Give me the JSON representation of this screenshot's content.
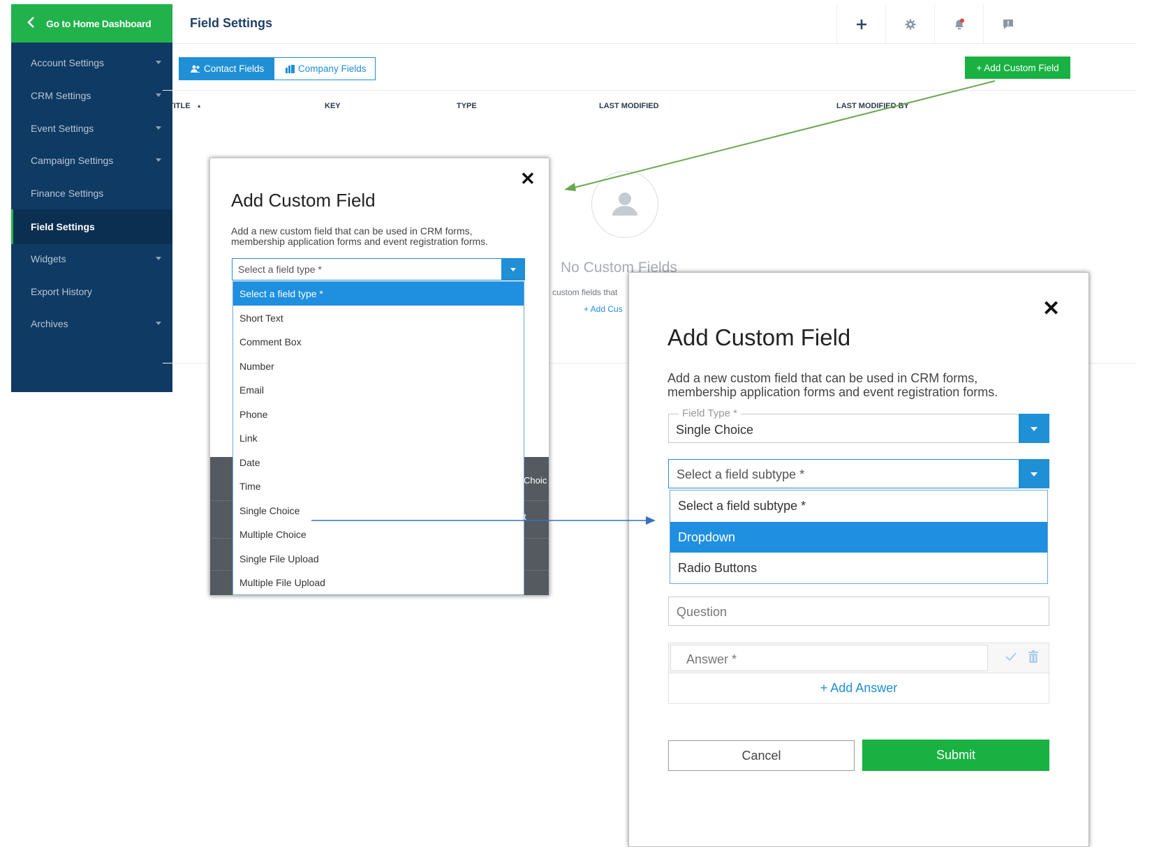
{
  "sidebar": {
    "home_label": "Go to Home Dashboard",
    "items": [
      {
        "label": "Account Settings",
        "caret": true
      },
      {
        "label": "CRM Settings",
        "caret": true
      },
      {
        "label": "Event Settings",
        "caret": true
      },
      {
        "label": "Campaign Settings",
        "caret": true
      },
      {
        "label": "Finance Settings",
        "caret": false
      },
      {
        "label": "Field Settings",
        "caret": false,
        "active": true
      },
      {
        "label": "Widgets",
        "caret": true
      },
      {
        "label": "Export History",
        "caret": false
      },
      {
        "label": "Archives",
        "caret": true
      }
    ]
  },
  "header": {
    "title": "Field Settings",
    "icons": [
      "plus-icon",
      "gear-icon",
      "bell-icon",
      "chat-icon"
    ]
  },
  "tabs": {
    "contact": "Contact Fields",
    "company": "Company Fields"
  },
  "toolbar": {
    "add_custom_field": "+ Add Custom Field"
  },
  "table": {
    "columns": [
      "TITLE",
      "KEY",
      "TYPE",
      "LAST MODIFIED",
      "LAST MODIFIED BY"
    ],
    "sort_indicator": "▲"
  },
  "empty_state": {
    "title": "No Custom Fields",
    "description": "custom fields that",
    "add_link": "+ Add Cus"
  },
  "modal_type_select": {
    "title": "Add Custom Field",
    "description": "Add a new custom field that can be used in CRM forms, membership application forms and event registration forms.",
    "select_placeholder": "Select a field type *",
    "options": [
      "Select a field type *",
      "Short Text",
      "Comment Box",
      "Number",
      "Email",
      "Phone",
      "Link",
      "Date",
      "Time",
      "Single Choice",
      "Multiple Choice",
      "Single File Upload",
      "Multiple File Upload"
    ],
    "selected_index": 0,
    "peek_text_1": "Choic",
    "peek_text_2": "t"
  },
  "modal_subtype_select": {
    "title": "Add Custom Field",
    "description": "Add a new custom field that can be used in CRM forms, membership application forms and event registration forms.",
    "field_type_label": "Field Type *",
    "field_type_value": "Single Choice",
    "subtype_placeholder": "Select a field subtype *",
    "subtype_options": [
      "Select a field subtype *",
      "Dropdown",
      "Radio Buttons"
    ],
    "highlighted_index": 1,
    "question_placeholder": "Question",
    "answer_placeholder": "Answer *",
    "add_answer": "+ Add Answer",
    "cancel": "Cancel",
    "submit": "Submit"
  },
  "colors": {
    "sidebar_bg": "#0e3a63",
    "brand_green": "#18b142",
    "accent_blue": "#1f8fd6",
    "arrow_green": "#6aa84f",
    "arrow_blue": "#3a6fc4"
  }
}
